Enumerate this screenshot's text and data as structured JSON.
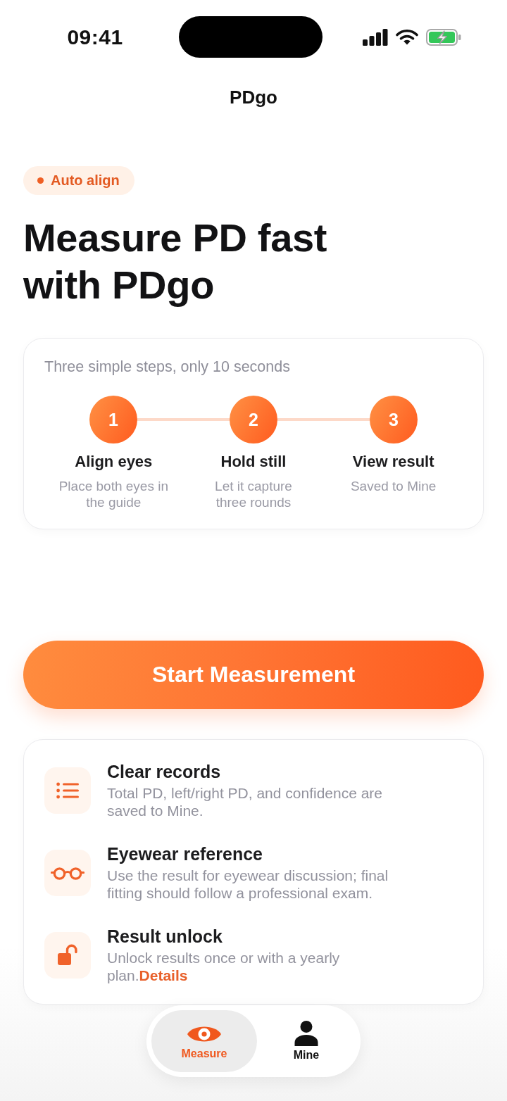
{
  "status_bar": {
    "time": "09:41"
  },
  "nav_bar": {
    "title": "PDgo"
  },
  "badge": {
    "label": "Auto align"
  },
  "headline": "Measure PD fast with PDgo",
  "steps_card": {
    "subtitle": "Three simple steps, only 10 seconds",
    "steps": [
      {
        "number": "1",
        "title": "Align eyes",
        "description": "Place both eyes in the guide"
      },
      {
        "number": "2",
        "title": "Hold still",
        "description": "Let it capture three rounds"
      },
      {
        "number": "3",
        "title": "View result",
        "description": "Saved to Mine"
      }
    ]
  },
  "primary_button": {
    "label": "Start Measurement"
  },
  "features": [
    {
      "title": "Clear records",
      "description": "Total PD, left/right PD, and confidence are saved to Mine."
    },
    {
      "title": "Eyewear reference",
      "description": "Use the result for eyewear discussion; final fitting should follow a professional exam."
    },
    {
      "title": "Result unlock",
      "description": "Unlock results once or with a yearly plan.",
      "link": "Details"
    }
  ],
  "tab_bar": {
    "tabs": [
      {
        "label": "Measure",
        "selected": true
      },
      {
        "label": "Mine",
        "selected": false
      }
    ]
  }
}
